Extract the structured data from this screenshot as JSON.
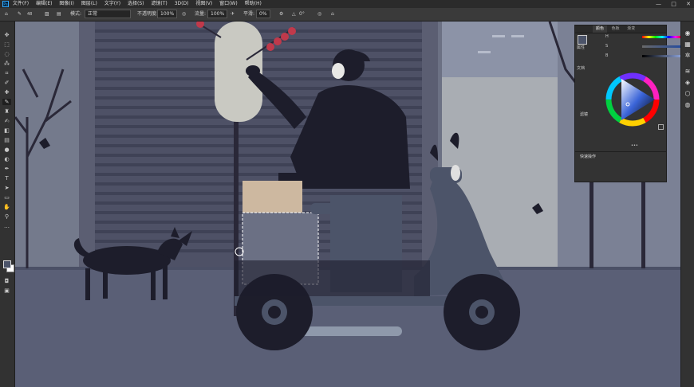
{
  "app": {
    "logo": "Ps"
  },
  "menu": {
    "items": [
      "文件(F)",
      "编辑(E)",
      "图像(I)",
      "图层(L)",
      "文字(Y)",
      "选择(S)",
      "滤镜(T)",
      "3D(D)",
      "视图(V)",
      "窗口(W)",
      "帮助(H)"
    ]
  },
  "window_controls": {
    "minimize": "—",
    "maximize": "□",
    "close": "✕"
  },
  "options": {
    "brush_size": "48",
    "mode_label": "模式:",
    "mode_value": "正常",
    "opacity_label": "不透明度:",
    "opacity_value": "100%",
    "flow_label": "流量:",
    "flow_value": "100%",
    "smooth_label": "平滑:",
    "smooth_value": "0%",
    "angle_value": "0°"
  },
  "tools": [
    "move-tool",
    "marquee-tool",
    "lasso-tool",
    "quick-select-tool",
    "crop-tool",
    "eyedropper-tool",
    "healing-tool",
    "brush-tool",
    "stamp-tool",
    "history-brush-tool",
    "eraser-tool",
    "gradient-tool",
    "blur-tool",
    "dodge-tool",
    "pen-tool",
    "type-tool",
    "path-select-tool",
    "shape-tool",
    "hand-tool",
    "zoom-tool",
    "more-tool"
  ],
  "color_panel": {
    "tabs": [
      "颜色",
      "色板",
      "渐变"
    ],
    "side_labels": [
      "属性",
      "文档"
    ],
    "h_label": "H",
    "h_value": "222",
    "s_label": "S",
    "s_value": "33",
    "s_unit": "%",
    "b_label": "B",
    "b_value": "41",
    "b_unit": "%",
    "section_filter": "滤镜",
    "section_quick": "快速操作",
    "more_dots": "•••"
  },
  "colors": {
    "foreground": "#4c5469",
    "background": "#ffffff",
    "hsb_selected": "#4c5469"
  }
}
